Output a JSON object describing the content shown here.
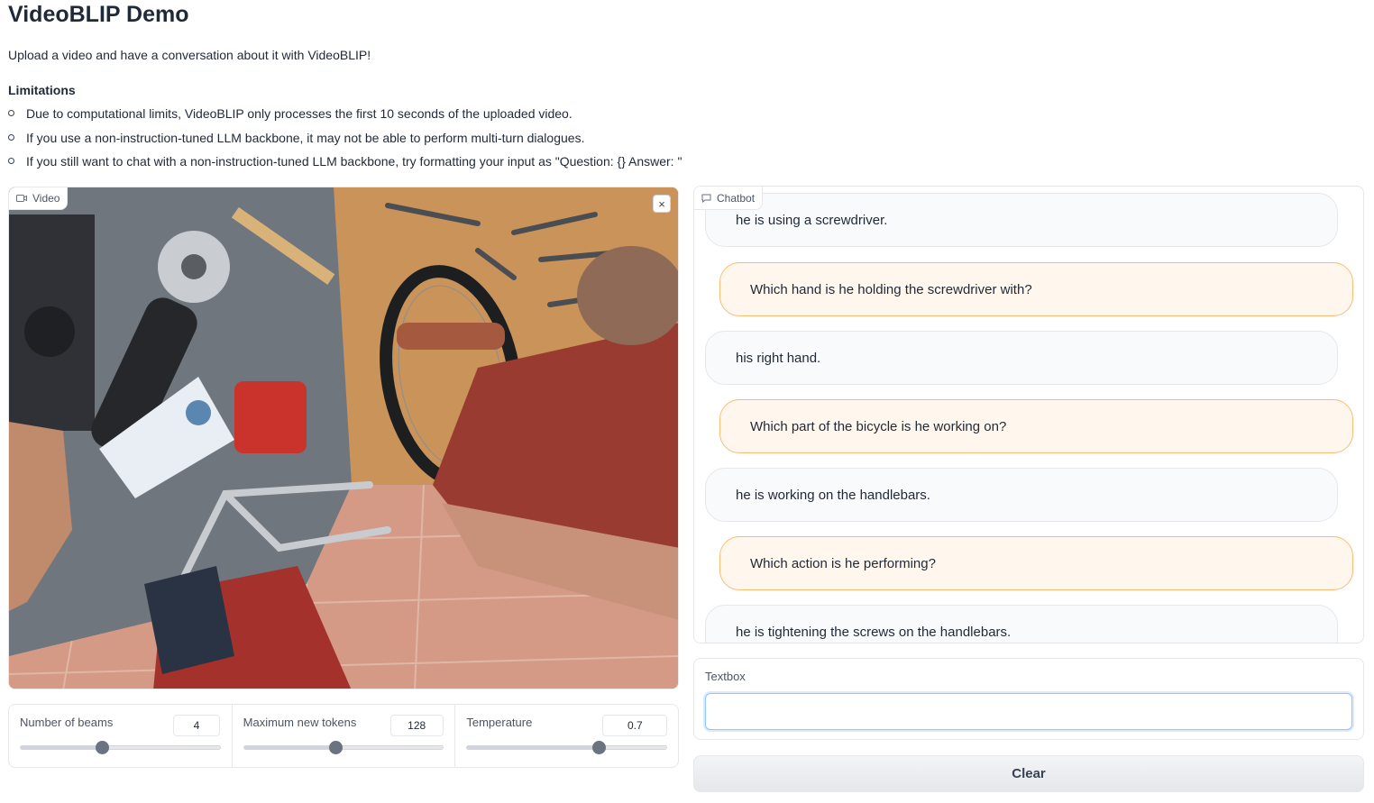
{
  "header": {
    "title": "VideoBLIP Demo",
    "description": "Upload a video and have a conversation about it with VideoBLIP!",
    "limitations_heading": "Limitations",
    "limitations": [
      "Due to computational limits, VideoBLIP only processes the first 10 seconds of the uploaded video.",
      "If you use a non-instruction-tuned LLM backbone, it may not be able to perform multi-turn dialogues.",
      "If you still want to chat with a non-instruction-tuned LLM backbone, try formatting your input as \"Question: {} Answer: \""
    ]
  },
  "video": {
    "label": "Video",
    "close_symbol": "×",
    "icon": "video-camera-icon"
  },
  "controls": [
    {
      "label": "Number of beams",
      "value": "4",
      "fraction": 0.41
    },
    {
      "label": "Maximum new tokens",
      "value": "128",
      "fraction": 0.46
    },
    {
      "label": "Temperature",
      "value": "0.7",
      "fraction": 0.66
    }
  ],
  "chatbot": {
    "label": "Chatbot",
    "icon": "chat-bubble-icon",
    "messages": [
      {
        "role": "bot",
        "text": "he is using a screwdriver."
      },
      {
        "role": "user",
        "text": "Which hand is he holding the screwdriver with?"
      },
      {
        "role": "bot",
        "text": "his right hand."
      },
      {
        "role": "user",
        "text": "Which part of the bicycle is he working on?"
      },
      {
        "role": "bot",
        "text": "he is working on the handlebars."
      },
      {
        "role": "user",
        "text": "Which action is he performing?"
      },
      {
        "role": "bot",
        "text": "he is tightening the screws on the handlebars."
      }
    ]
  },
  "textbox": {
    "label": "Textbox",
    "value": "",
    "placeholder": ""
  },
  "clear_button": {
    "label": "Clear"
  },
  "colors": {
    "user_bubble": "#fff7ed",
    "user_border": "#fdba74",
    "bot_bubble": "#f9fafb",
    "focus_ring": "#93c5fd"
  }
}
